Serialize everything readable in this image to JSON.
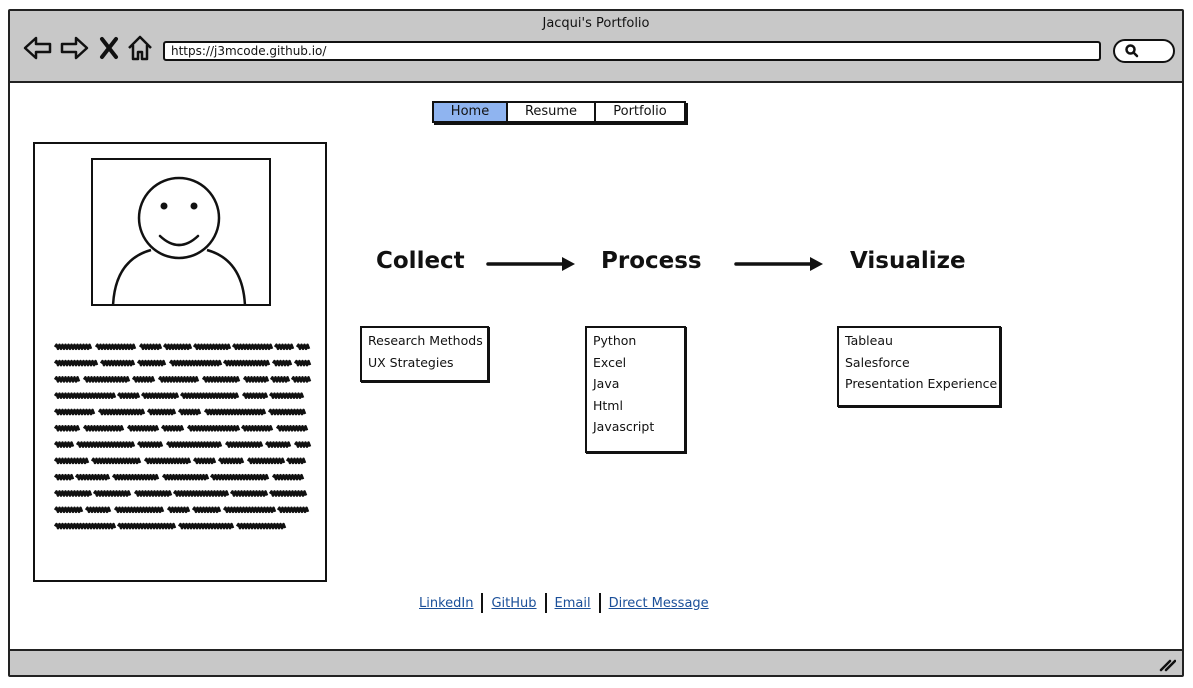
{
  "window": {
    "title": "Jacqui's Portfolio"
  },
  "browser": {
    "url": "https://j3mcode.github.io/",
    "icons": [
      "back-arrow-icon",
      "forward-arrow-icon",
      "close-x-icon",
      "home-icon",
      "search-icon",
      "resize-grip-icon"
    ]
  },
  "nav": {
    "tabs": [
      {
        "label": "Home",
        "active": true
      },
      {
        "label": "Resume",
        "active": false
      },
      {
        "label": "Portfolio",
        "active": false
      }
    ],
    "active_color": "#8fb4f0"
  },
  "profile": {
    "avatar_icon": "smiley-avatar-icon"
  },
  "pipeline": {
    "stages": [
      "Collect",
      "Process",
      "Visualize"
    ],
    "collect_skills": [
      "Research Methods",
      "UX Strategies"
    ],
    "process_skills": [
      "Python",
      "Excel",
      "Java",
      "Html",
      "Javascript"
    ],
    "visualize_skills": [
      "Tableau",
      "Salesforce",
      "Presentation Experience"
    ]
  },
  "footer": {
    "links": [
      "LinkedIn",
      "GitHub",
      "Email",
      "Direct Message"
    ],
    "link_color": "#1a4f99"
  }
}
